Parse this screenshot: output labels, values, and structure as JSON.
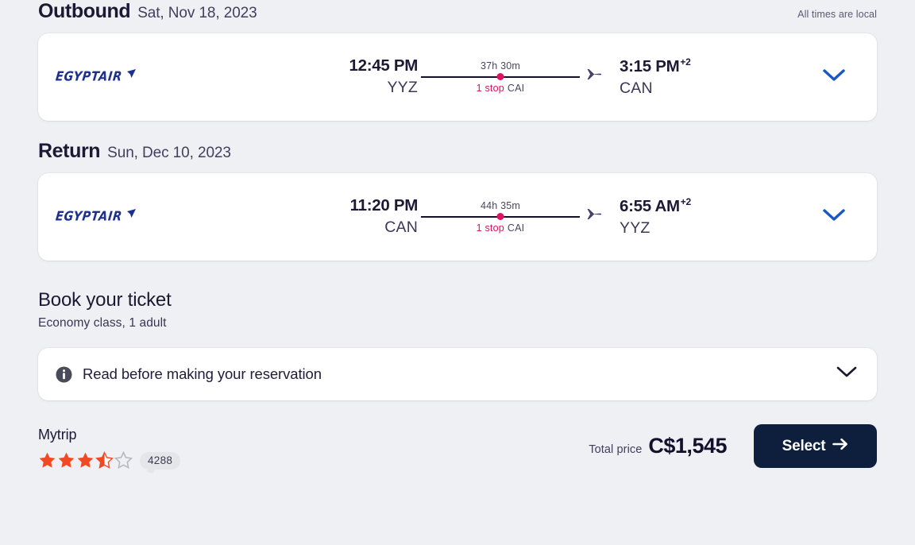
{
  "meta": {
    "all_times_note": "All times are local",
    "accent_pink": "#e0115f",
    "accent_blue": "#1a56c4",
    "brand_navy": "#0d1f3c",
    "star_color": "#f04923",
    "airline_logo_color": "#1d2f8f"
  },
  "outbound": {
    "title": "Outbound",
    "date": "Sat, Nov 18, 2023",
    "airline": "EGYPTAIR",
    "depart_time": "12:45 PM",
    "depart_day_offset": "",
    "depart_code": "YYZ",
    "duration": "37h 30m",
    "stops_count": "1 stop",
    "stops_via": "CAI",
    "arrive_time": "3:15 PM",
    "arrive_day_offset": "+2",
    "arrive_code": "CAN"
  },
  "return": {
    "title": "Return",
    "date": "Sun, Dec 10, 2023",
    "airline": "EGYPTAIR",
    "depart_time": "11:20 PM",
    "depart_day_offset": "",
    "depart_code": "CAN",
    "duration": "44h 35m",
    "stops_count": "1 stop",
    "stops_via": "CAI",
    "arrive_time": "6:55 AM",
    "arrive_day_offset": "+2",
    "arrive_code": "YYZ"
  },
  "booking": {
    "heading": "Book your ticket",
    "subheading": "Economy class, 1 adult",
    "notice_text": "Read before making your reservation"
  },
  "footer": {
    "provider": "Mytrip",
    "rating_value": 3.5,
    "rating_max": 5,
    "review_count": "4288",
    "price_label": "Total price",
    "price_value": "C$1,545",
    "select_label": "Select"
  }
}
